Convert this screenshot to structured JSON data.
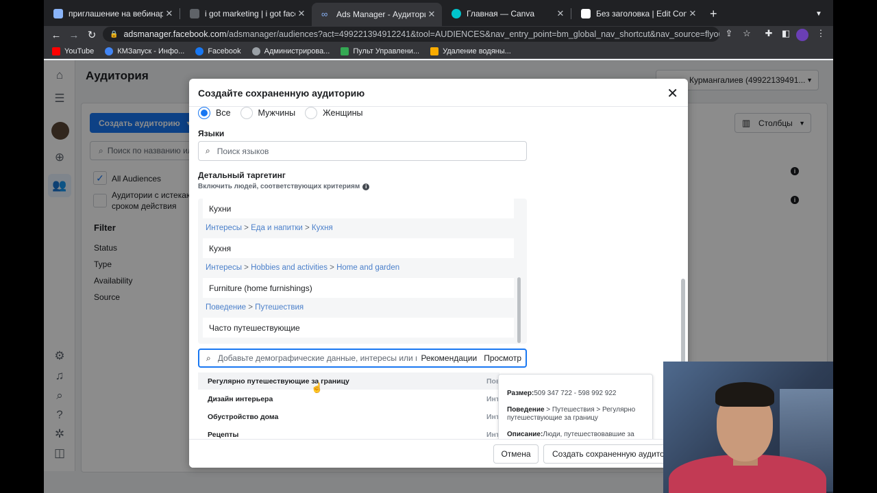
{
  "browser": {
    "tabs": [
      {
        "title": "приглашение на вебинар — П",
        "color": "#8ab4f8"
      },
      {
        "title": "i got marketing | i got facebook",
        "color": "#5f6368"
      },
      {
        "title": "Ads Manager - Аудитории",
        "color": "#1877f2"
      },
      {
        "title": "Главная — Canva",
        "color": "#00c4cc"
      },
      {
        "title": "Без заголовка | Edit Content",
        "color": "#ffffff"
      }
    ],
    "new_tab": "+",
    "url_domain": "adsmanager.facebook.com",
    "url_rest": "/adsmanager/audiences?act=499221394912241&tool=AUDIENCES&nav_entry_point=bm_global_nav_shortcut&nav_source=flyout_me...",
    "bookmarks": [
      {
        "label": "YouTube",
        "color": "#ff0000"
      },
      {
        "label": "КМЗапуск - Инфо...",
        "color": "#4285f4"
      },
      {
        "label": "Facebook",
        "color": "#1877f2"
      },
      {
        "label": "Администрирова...",
        "color": "#9aa0a6"
      },
      {
        "label": "Пульт Управлени...",
        "color": "#34a853"
      },
      {
        "label": "Удаление водяны...",
        "color": "#f9ab00"
      }
    ]
  },
  "background_page": {
    "title": "Аудитория",
    "account": "Курмангалиев (49922139491...",
    "create_button": "Создать аудиторию",
    "search_placeholder": "Поиск по названию или",
    "all_audiences": "All Audiences",
    "expiring_line1": "Аудитории с истекаю",
    "expiring_line2": "сроком действия",
    "filter_title": "Filter",
    "filters": [
      "Status",
      "Type",
      "Availability",
      "Source"
    ],
    "columns_button": "Столбцы"
  },
  "modal": {
    "title": "Создайте сохраненную аудиторию",
    "gender_options": [
      "Все",
      "Мужчины",
      "Женщины"
    ],
    "languages_label": "Языки",
    "languages_placeholder": "Поиск языков",
    "detailed_targeting_label": "Детальный таргетинг",
    "detailed_targeting_sub": "Включить людей, соответствующих критериям",
    "targeting": {
      "item_top": "Кухни",
      "path1": {
        "a": "Интересы",
        "b": "Еда и напитки",
        "c": "Кухня"
      },
      "item1": "Кухня",
      "path2": {
        "a": "Интересы",
        "b": "Hobbies and activities",
        "c": "Home and garden"
      },
      "item2": "Furniture (home furnishings)",
      "path3": {
        "a": "Поведение",
        "b": "Путешествия"
      },
      "item3": "Часто путешествующие"
    },
    "search_placeholder": "Добавьте демографические данные, интересы или модели",
    "recommendations": "Рекомендации",
    "browse": "Просмотр",
    "suggestions": [
      {
        "label": "Регулярно путешествующие за границу",
        "category": "Поведе"
      },
      {
        "label": "Дизайн интерьера",
        "category": "Интере"
      },
      {
        "label": "Обустройство дома",
        "category": "Интере"
      },
      {
        "label": "Рецепты",
        "category": "Интере"
      }
    ],
    "tooltip": {
      "size_label": "Размер:",
      "size_value": "509 347 722 - 598 992 922",
      "path_label": "Поведение",
      "path_value": " > Путешествия > Регулярно путешествующие за границу",
      "desc_label": "Описание:",
      "desc_value": "Люди, путешествовавшие за границу более одного раза"
    },
    "cancel": "Отмена",
    "save": "Создать сохраненную аудиторию"
  }
}
